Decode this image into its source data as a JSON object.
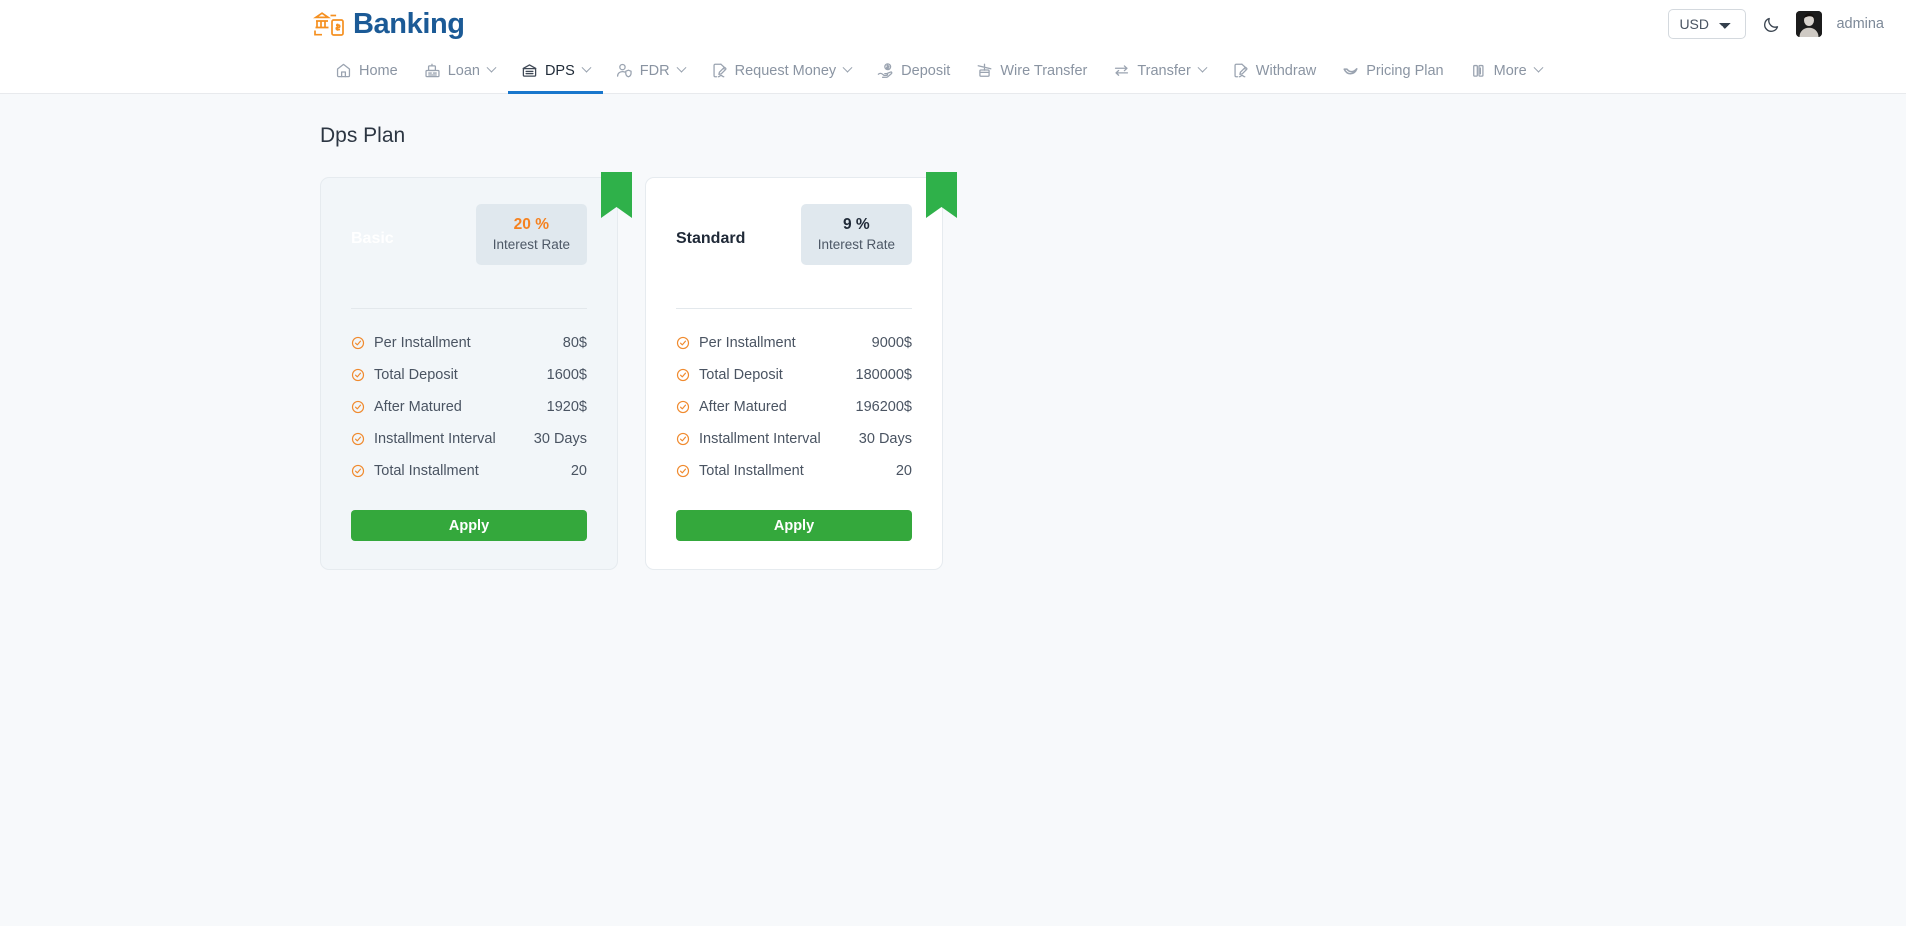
{
  "header": {
    "brand_name": "Banking",
    "brand_icon": "bank-phone-logo-icon",
    "currency_selected": "USD",
    "currency_options": [
      "USD"
    ],
    "theme_toggle_icon": "moon-icon",
    "avatar_icon": "user-avatar",
    "username": "admina"
  },
  "nav": {
    "items": [
      {
        "label": "Home",
        "icon": "home-icon",
        "caret": false,
        "active": false
      },
      {
        "label": "Loan",
        "icon": "cash-register-icon",
        "caret": true,
        "active": false
      },
      {
        "label": "DPS",
        "icon": "bank-archive-icon",
        "caret": true,
        "active": true
      },
      {
        "label": "FDR",
        "icon": "user-shield-icon",
        "caret": true,
        "active": false
      },
      {
        "label": "Request Money",
        "icon": "file-signature-icon",
        "caret": true,
        "active": false
      },
      {
        "label": "Deposit",
        "icon": "hand-dollar-icon",
        "caret": false,
        "active": false
      },
      {
        "label": "Wire Transfer",
        "icon": "money-transfer-icon",
        "caret": false,
        "active": false
      },
      {
        "label": "Transfer",
        "icon": "exchange-arrows-icon",
        "caret": true,
        "active": false
      },
      {
        "label": "Withdraw",
        "icon": "file-signature-icon",
        "caret": false,
        "active": false
      },
      {
        "label": "Pricing Plan",
        "icon": "swoosh-icon",
        "caret": false,
        "active": false
      },
      {
        "label": "More",
        "icon": "briefcase-icon",
        "caret": true,
        "active": false
      }
    ]
  },
  "main": {
    "page_title": "Dps Plan",
    "colors": {
      "accent_green": "#34a83c",
      "accent_orange": "#f58220",
      "brand_blue": "#1b5a96",
      "ribbon_green": "#2fb14a"
    },
    "plans": [
      {
        "name": "Basic",
        "name_style": "muted",
        "rate_value": "20 %",
        "rate_value_style": "accent",
        "rate_label": "Interest Rate",
        "card_style": "tint",
        "ribbon": true,
        "rows": [
          {
            "label": "Per Installment",
            "value": "80$"
          },
          {
            "label": "Total Deposit",
            "value": "1600$"
          },
          {
            "label": "After Matured",
            "value": "1920$"
          },
          {
            "label": "Installment Interval",
            "value": "30 Days"
          },
          {
            "label": "Total Installment",
            "value": "20"
          }
        ],
        "apply_label": "Apply"
      },
      {
        "name": "Standard",
        "name_style": "normal",
        "rate_value": "9 %",
        "rate_value_style": "normal",
        "rate_label": "Interest Rate",
        "card_style": "plain",
        "ribbon": true,
        "rows": [
          {
            "label": "Per Installment",
            "value": "9000$"
          },
          {
            "label": "Total Deposit",
            "value": "180000$"
          },
          {
            "label": "After Matured",
            "value": "196200$"
          },
          {
            "label": "Installment Interval",
            "value": "30 Days"
          },
          {
            "label": "Total Installment",
            "value": "20"
          }
        ],
        "apply_label": "Apply"
      }
    ]
  }
}
